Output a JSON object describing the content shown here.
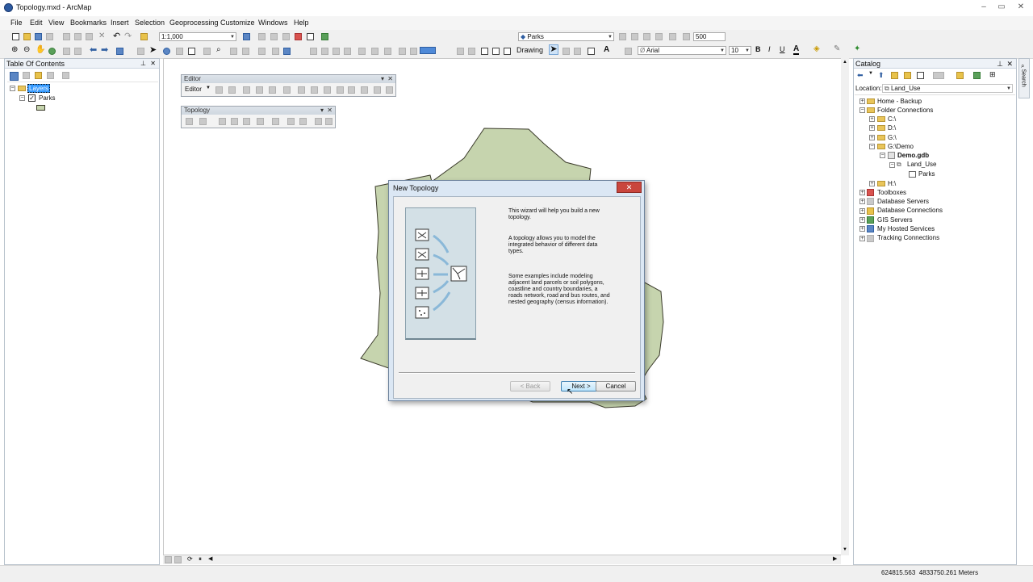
{
  "window": {
    "title": "Topology.mxd - ArcMap"
  },
  "menu": [
    "File",
    "Edit",
    "View",
    "Bookmarks",
    "Insert",
    "Selection",
    "Geoprocessing",
    "Customize",
    "Windows",
    "Help"
  ],
  "toolbar": {
    "scale": "1:1,000",
    "layer_combo": "Parks",
    "snap_value": "500",
    "drawing_label": "Drawing",
    "font_name": "Arial",
    "font_size": "10",
    "bold": "B",
    "italic": "I",
    "underline": "U"
  },
  "toc": {
    "title": "Table Of Contents",
    "layers_label": "Layers",
    "layer_name": "Parks"
  },
  "editor": {
    "title": "Editor",
    "menu_label": "Editor"
  },
  "topology_bar": {
    "title": "Topology"
  },
  "dialog": {
    "title": "New Topology",
    "close_glyph": "✕",
    "para1": "This wizard will help you build a new topology.",
    "para2": "A topology allows you to model the integrated behavior of different data types.",
    "para3": "Some examples include modeling adjacent land parcels or soil polygons, coastline and country boundaries, a roads network, road and bus routes, and nested geography (census information).",
    "back_label": "< Back",
    "next_label": "Next >",
    "cancel_label": "Cancel"
  },
  "catalog": {
    "title": "Catalog",
    "location_label": "Location:",
    "location_value": "Land_Use",
    "search_label": "Search",
    "items": [
      "Home - Backup",
      "Folder Connections",
      "C:\\",
      "D:\\",
      "G:\\",
      "G:\\Demo",
      "Demo.gdb",
      "Land_Use",
      "Parks",
      "H:\\",
      "Toolboxes",
      "Database Servers",
      "Database Connections",
      "GIS Servers",
      "My Hosted Services",
      "Tracking Connections"
    ]
  },
  "status": {
    "coords": "624815.563  4833750.261 Meters"
  },
  "colors": {
    "polygon_fill": "#c6d4ae",
    "polygon_stroke": "#3a3a2a",
    "selection": "#3399ff"
  }
}
